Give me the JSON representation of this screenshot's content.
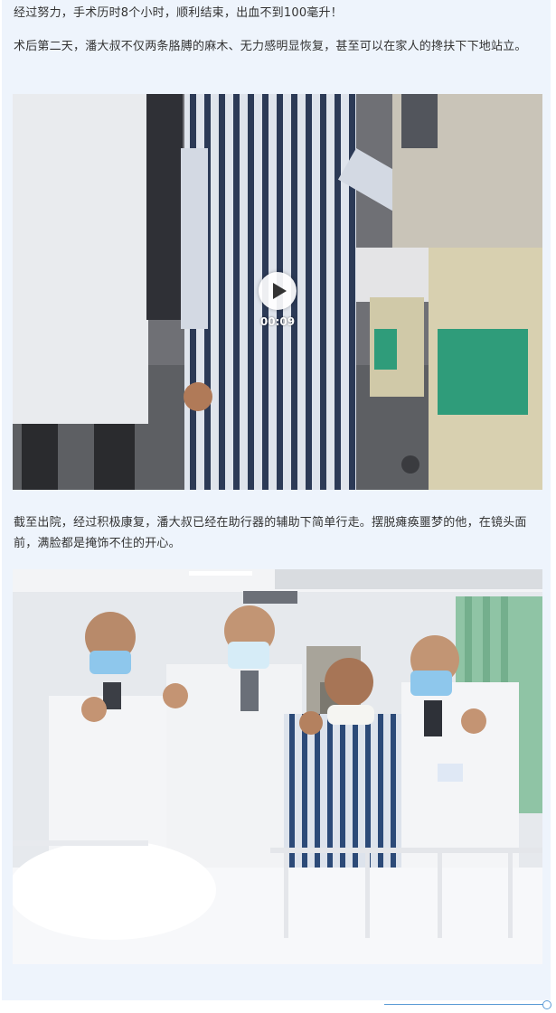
{
  "article": {
    "paragraph_1": "经过努力，手术历时8个小时，顺利结束，出血不到100毫升！",
    "paragraph_2": "术后第二天，潘大叔不仅两条胳膊的麻木、无力感明显恢复，甚至可以在家人的搀扶下下地站立。",
    "paragraph_3": "截至出院，经过积极康复，潘大叔已经在助行器的辅助下简单行走。摆脱瘫痪噩梦的他，在镜头面前，满脸都是掩饰不住的开心。"
  },
  "video": {
    "duration": "00:09",
    "play_icon": "play-icon"
  },
  "colors": {
    "page_background": "#eef4fc",
    "text": "#333333",
    "accent_line": "#5b9bd5"
  }
}
